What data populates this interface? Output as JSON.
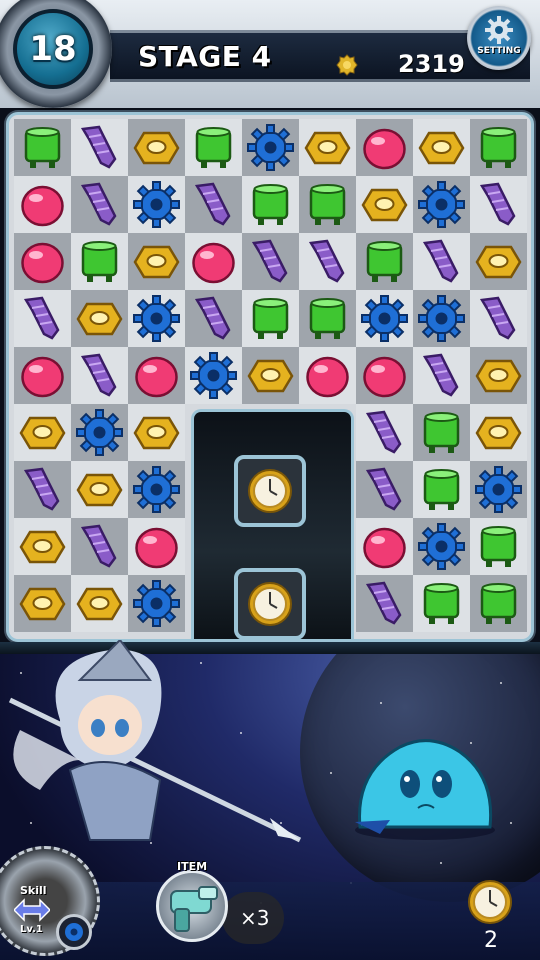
{
  "hud": {
    "moves_left": "18",
    "stage_label": "STAGE 4",
    "score": "2319",
    "setting_label": "SETTING"
  },
  "board": {
    "rows": 9,
    "cols": 9,
    "legend": {
      "G": "green-canister",
      "S": "purple-screw",
      "N": "yellow-nut",
      "C": "blue-cog",
      "R": "red-drop",
      "X": "empty"
    },
    "grid": [
      [
        "G",
        "S",
        "N",
        "G",
        "C",
        "N",
        "R",
        "N",
        "G"
      ],
      [
        "R",
        "S",
        "C",
        "S",
        "G",
        "G",
        "N",
        "C",
        "S"
      ],
      [
        "R",
        "G",
        "N",
        "R",
        "S",
        "S",
        "G",
        "S",
        "N"
      ],
      [
        "S",
        "N",
        "C",
        "S",
        "G",
        "G",
        "C",
        "C",
        "S"
      ],
      [
        "R",
        "S",
        "R",
        "C",
        "N",
        "R",
        "R",
        "S",
        "N"
      ],
      [
        "N",
        "C",
        "N",
        "X",
        "X",
        "X",
        "S",
        "G",
        "N"
      ],
      [
        "S",
        "N",
        "C",
        "X",
        "X",
        "X",
        "S",
        "G",
        "C"
      ],
      [
        "N",
        "S",
        "R",
        "X",
        "X",
        "X",
        "R",
        "C",
        "G"
      ],
      [
        "N",
        "N",
        "C",
        "X",
        "X",
        "X",
        "S",
        "G",
        "G"
      ]
    ],
    "clock_targets": [
      "clock-icon",
      "clock-icon"
    ]
  },
  "battle": {
    "skill_label": "Skill",
    "skill_level": "Lv.1",
    "item_label": "ITEM",
    "item_count": "×3",
    "clock_count": "2"
  },
  "colors": {
    "accent": "#9cc4d6",
    "green": "#3fc631",
    "purple": "#8a5cc8",
    "yellow": "#e5b21f",
    "blue": "#1f6fd6",
    "red": "#f03b74"
  }
}
